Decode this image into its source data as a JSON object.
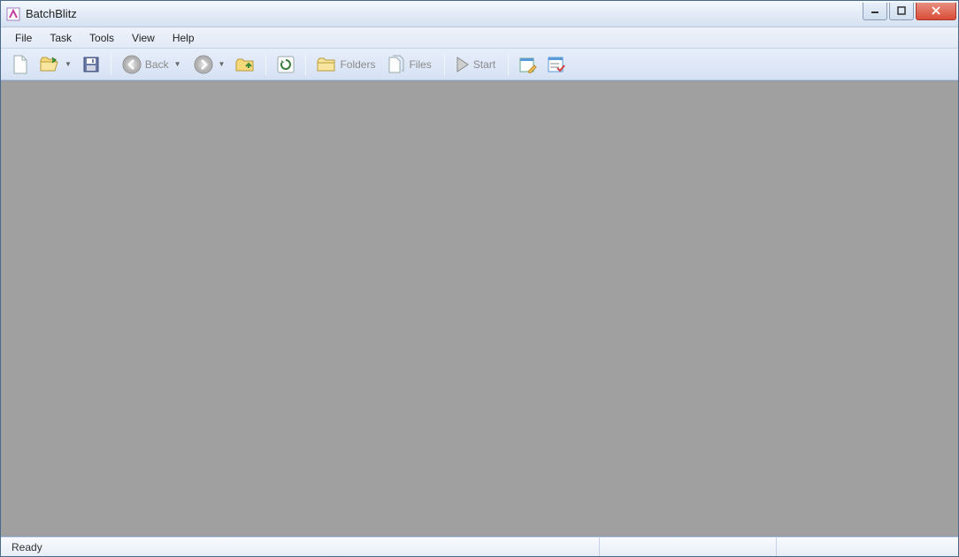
{
  "window": {
    "title": "BatchBlitz"
  },
  "menu": {
    "items": [
      "File",
      "Task",
      "Tools",
      "View",
      "Help"
    ]
  },
  "toolbar": {
    "back_label": "Back",
    "folders_label": "Folders",
    "files_label": "Files",
    "start_label": "Start"
  },
  "status": {
    "text": "Ready"
  }
}
